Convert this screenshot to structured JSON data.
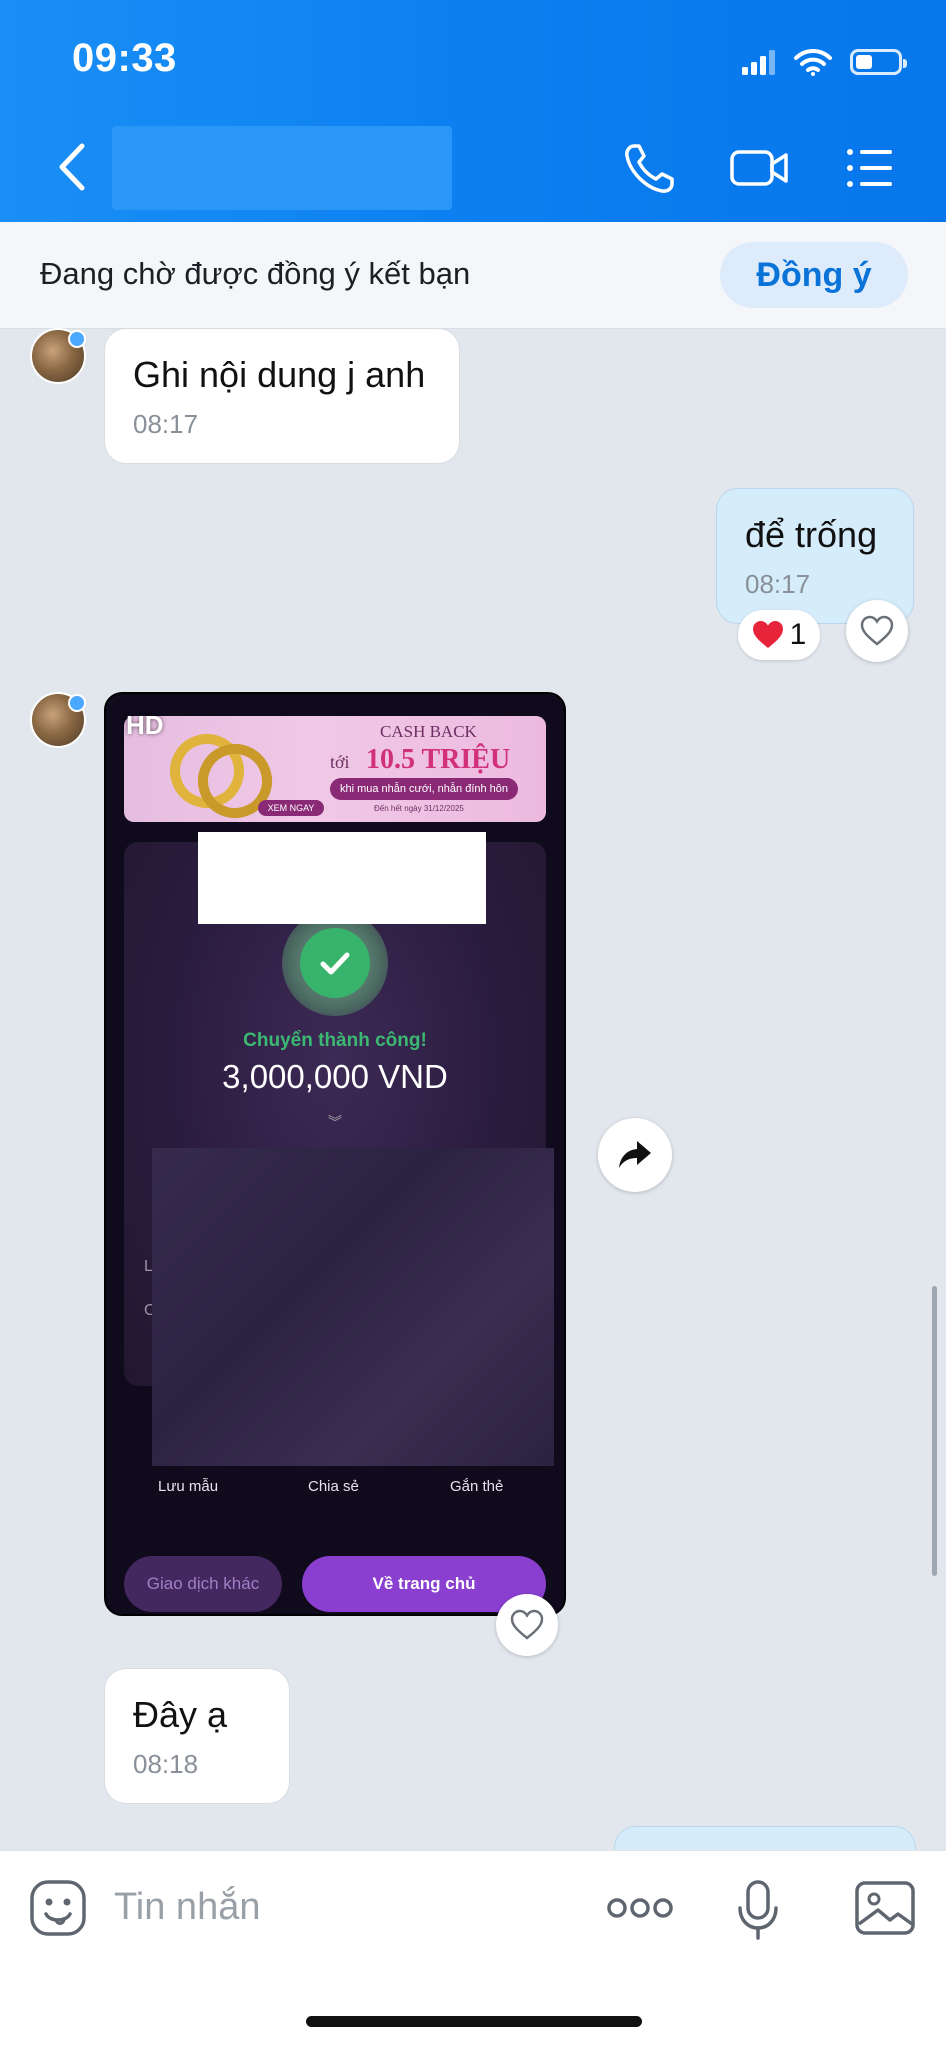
{
  "status_bar": {
    "time": "09:33"
  },
  "friend_request": {
    "text": "Đang chờ được đồng ý kết bạn",
    "accept_label": "Đồng ý"
  },
  "messages": [
    {
      "direction": "in",
      "text": "Ghi nội dung j anh",
      "time": "08:17"
    },
    {
      "direction": "out",
      "text": "để trống",
      "time": "08:17",
      "reaction": {
        "emoji": "❤️",
        "count": "1"
      }
    },
    {
      "direction": "in",
      "text": "Đây ạ",
      "time": "08:18"
    }
  ],
  "image_message": {
    "hd_badge": "HD",
    "banner": {
      "line1": "CASH BACK",
      "toi": "tới",
      "amount": "10.5 TRIỆU",
      "pill": "khi mua nhẫn cưới, nhẫn đính hôn",
      "cta": "XEM NGAY",
      "date": "Đến hết ngày 31/12/2025"
    },
    "status": "Chuyển thành công!",
    "amount": "3,000,000 VND",
    "side_labels": [
      "L",
      "C"
    ],
    "actions": [
      "Lưu mẫu",
      "Chia sẻ",
      "Gắn thẻ"
    ],
    "other_button": "Giao dịch khác",
    "home_button": "Về trang chủ"
  },
  "composer": {
    "placeholder": "Tin nhắn"
  },
  "colors": {
    "header_blue": "#0b7ef0",
    "accent": "#0a73d8",
    "success_green": "#37b36b",
    "bubble_out": "#d5ecfb"
  },
  "icons": [
    "chevron-left-icon",
    "phone-icon",
    "video-icon",
    "list-icon",
    "heart-icon",
    "share-icon",
    "sticker-icon",
    "more-icon",
    "mic-icon",
    "image-icon"
  ]
}
